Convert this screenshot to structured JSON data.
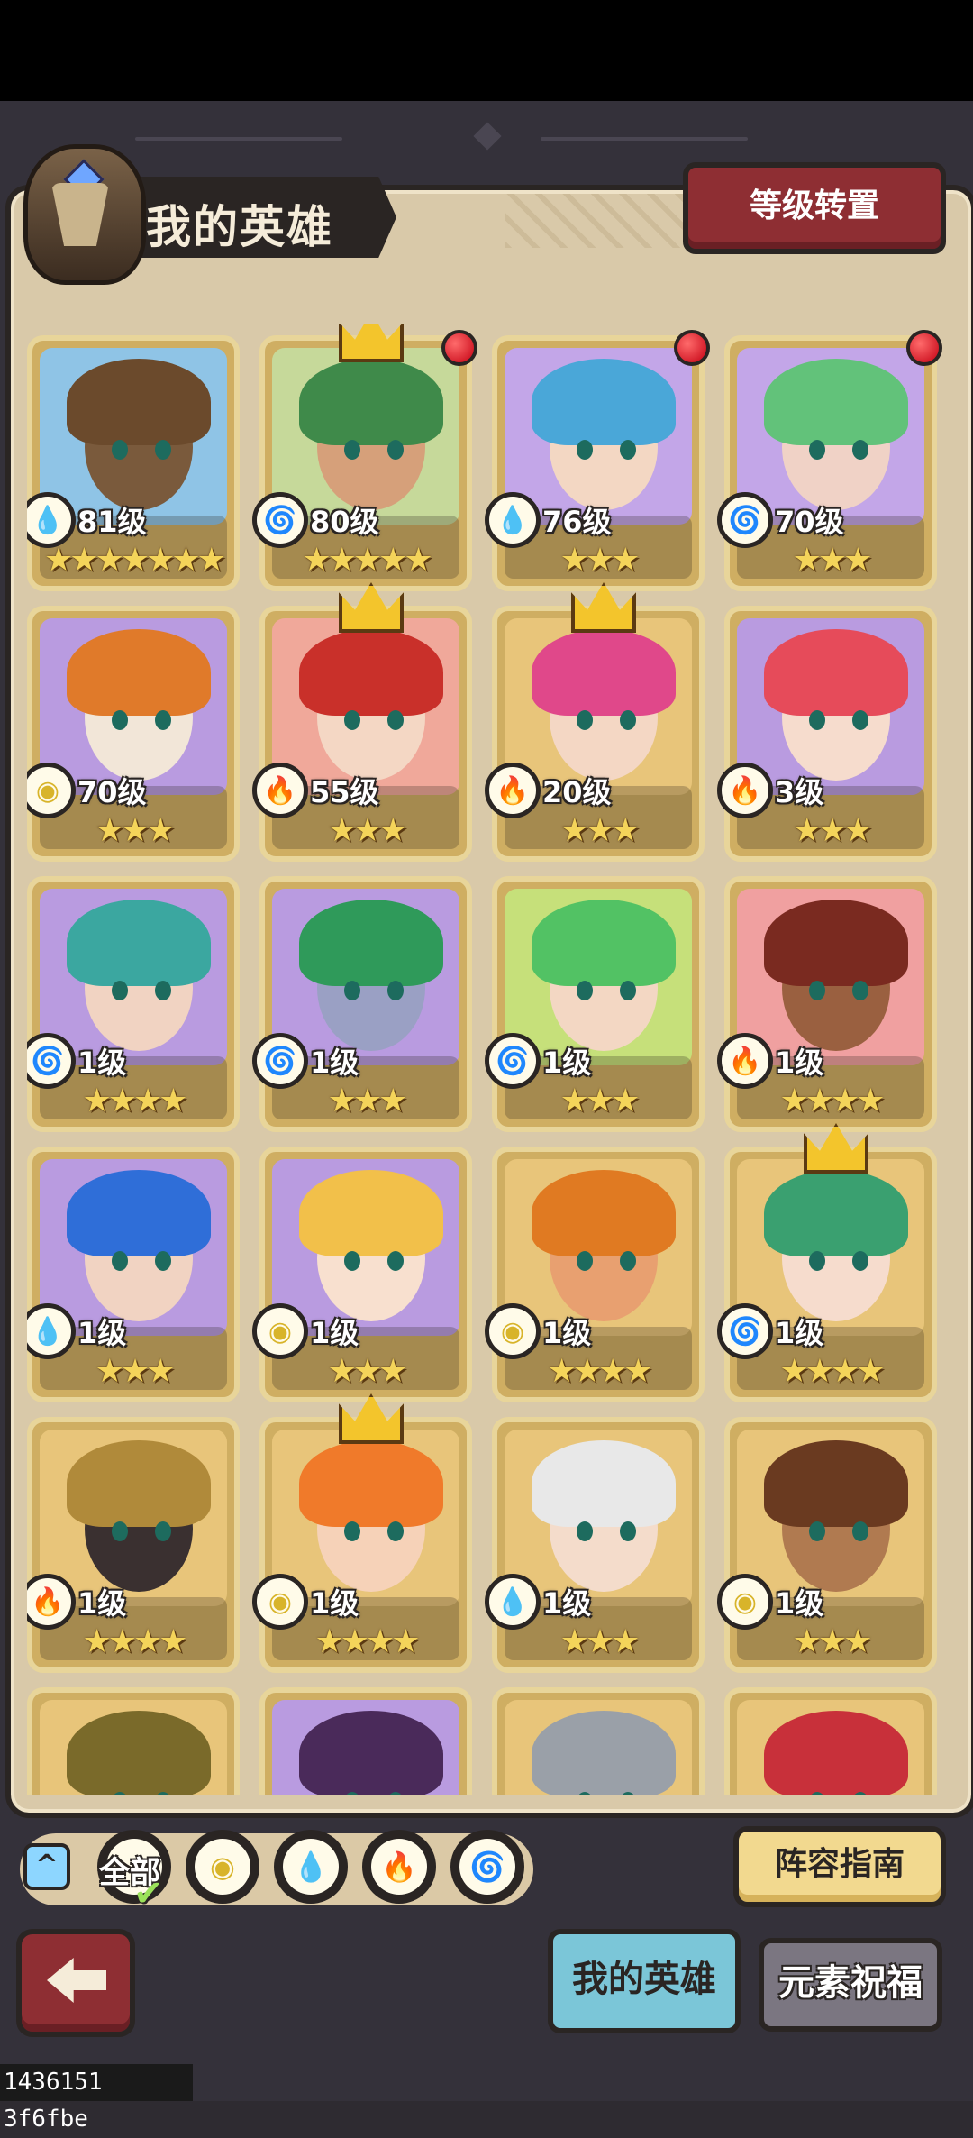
{
  "header": {
    "title": "我的英雄",
    "level_transfer_button": "等级转置"
  },
  "heroes": [
    {
      "level": "81级",
      "stars": 7,
      "element": "water",
      "crown": false,
      "notify": false,
      "bg": "#8fc4e6",
      "hair": "#6b4a2c",
      "face": "#7a5a3c"
    },
    {
      "level": "80级",
      "stars": 5,
      "element": "wind",
      "crown": true,
      "notify": true,
      "bg": "#c6d99a",
      "hair": "#3f8a4a",
      "face": "#d6a07a"
    },
    {
      "level": "76级",
      "stars": 3,
      "element": "water",
      "crown": false,
      "notify": true,
      "bg": "#c3a6e8",
      "hair": "#4aa7d8",
      "face": "#f3d7c3"
    },
    {
      "level": "70级",
      "stars": 3,
      "element": "wind",
      "crown": false,
      "notify": true,
      "bg": "#c3a6e8",
      "hair": "#62c27a",
      "face": "#f0d2c6"
    },
    {
      "level": "70级",
      "stars": 3,
      "element": "earth",
      "crown": false,
      "notify": false,
      "bg": "#b99be0",
      "hair": "#e07a2a",
      "face": "#f2e6d8"
    },
    {
      "level": "55级",
      "stars": 3,
      "element": "fire",
      "crown": true,
      "notify": false,
      "bg": "#f0a89a",
      "hair": "#c9302a",
      "face": "#f4d7c4"
    },
    {
      "level": "20级",
      "stars": 3,
      "element": "fire",
      "crown": true,
      "notify": false,
      "bg": "#e8c57a",
      "hair": "#e0488a",
      "face": "#f4d7c4"
    },
    {
      "level": "3级",
      "stars": 3,
      "element": "fire",
      "crown": false,
      "notify": false,
      "bg": "#b99be0",
      "hair": "#e64b5a",
      "face": "#f6dccd"
    },
    {
      "level": "1级",
      "stars": 4,
      "element": "wind",
      "crown": false,
      "notify": false,
      "bg": "#b99be0",
      "hair": "#3ba7a0",
      "face": "#f1d3c2"
    },
    {
      "level": "1级",
      "stars": 3,
      "element": "wind",
      "crown": false,
      "notify": false,
      "bg": "#b99be0",
      "hair": "#2f9a5a",
      "face": "#9aa0c4"
    },
    {
      "level": "1级",
      "stars": 3,
      "element": "wind",
      "crown": false,
      "notify": false,
      "bg": "#c6e07a",
      "hair": "#52c264",
      "face": "#f3d7c3"
    },
    {
      "level": "1级",
      "stars": 4,
      "element": "fire",
      "crown": false,
      "notify": false,
      "bg": "#f0a0a0",
      "hair": "#7a2a20",
      "face": "#9a6040"
    },
    {
      "level": "1级",
      "stars": 3,
      "element": "water",
      "crown": false,
      "notify": false,
      "bg": "#b99be0",
      "hair": "#2f6ed8",
      "face": "#f1d3c2"
    },
    {
      "level": "1级",
      "stars": 3,
      "element": "earth",
      "crown": false,
      "notify": false,
      "bg": "#b99be0",
      "hair": "#f2c04a",
      "face": "#f8e0cf"
    },
    {
      "level": "1级",
      "stars": 4,
      "element": "earth",
      "crown": false,
      "notify": false,
      "bg": "#e8c57a",
      "hair": "#e07a22",
      "face": "#e8a070"
    },
    {
      "level": "1级",
      "stars": 4,
      "element": "wind",
      "crown": true,
      "notify": false,
      "bg": "#e8c57a",
      "hair": "#3aa070",
      "face": "#f6dccd"
    },
    {
      "level": "1级",
      "stars": 4,
      "element": "fire",
      "crown": false,
      "notify": false,
      "bg": "#e8c57a",
      "hair": "#b08a3a",
      "face": "#3a3030"
    },
    {
      "level": "1级",
      "stars": 4,
      "element": "earth",
      "crown": true,
      "notify": false,
      "bg": "#e8c57a",
      "hair": "#f07a2a",
      "face": "#f6d2b8"
    },
    {
      "level": "1级",
      "stars": 3,
      "element": "water",
      "crown": false,
      "notify": false,
      "bg": "#e8c57a",
      "hair": "#e8e8e8",
      "face": "#f4dccb"
    },
    {
      "level": "1级",
      "stars": 3,
      "element": "earth",
      "crown": false,
      "notify": false,
      "bg": "#e8c57a",
      "hair": "#6a3a20",
      "face": "#b07a50"
    },
    {
      "level": "",
      "stars": 0,
      "element": "",
      "crown": false,
      "notify": false,
      "bg": "#e8c57a",
      "hair": "#7a6a2a",
      "face": "#8a7a3a"
    },
    {
      "level": "",
      "stars": 0,
      "element": "",
      "crown": false,
      "notify": false,
      "bg": "#b99be0",
      "hair": "#4a2a5a",
      "face": "#9ab060"
    },
    {
      "level": "",
      "stars": 0,
      "element": "",
      "crown": false,
      "notify": false,
      "bg": "#e8c57a",
      "hair": "#9aa0a8",
      "face": "#c8ccd0"
    },
    {
      "level": "",
      "stars": 0,
      "element": "",
      "crown": false,
      "notify": false,
      "bg": "#e8c57a",
      "hair": "#c8303a",
      "face": "#f6dccd"
    }
  ],
  "element_colors": {
    "water": "#3a8fd8",
    "wind": "#56b43a",
    "earth": "#d8b42a",
    "fire": "#e0463a"
  },
  "element_glyphs": {
    "water": "💧",
    "wind": "🌀",
    "earth": "◉",
    "fire": "🔥"
  },
  "filters": {
    "collapse_icon": "^",
    "all_label": "全部",
    "items": [
      "earth",
      "water",
      "fire",
      "wind"
    ]
  },
  "buttons": {
    "lineup_guide": "阵容指南"
  },
  "tabs": {
    "my_heroes": "我的英雄",
    "element_blessing": "元素祝福"
  },
  "footer_id": "1436151 3f6fbe"
}
